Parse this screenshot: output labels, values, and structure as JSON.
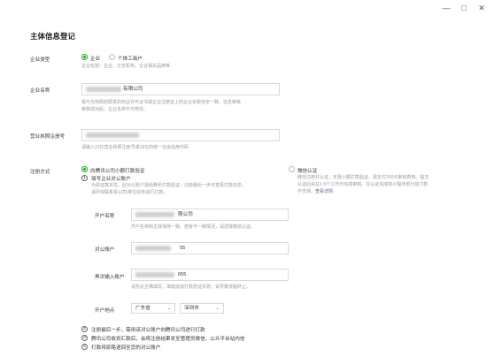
{
  "window": {
    "minimize": "—",
    "maximize": "□",
    "close": "✕"
  },
  "page_title": "主体信息登记",
  "company_type": {
    "label": "企业类型",
    "options": [
      "企业",
      "个体工商户"
    ],
    "selected": "企业",
    "hint": "企业包括：企业、分支机构、企业相关品牌等"
  },
  "company_name": {
    "label": "企业名称",
    "value_suffix": "有限公司",
    "hint_line1": "需与当地政府颁发的商业许可证书或企业注册证上的企业名称完全一致，信息审核",
    "hint_line2": "审核成功后，企业名称不可修改。"
  },
  "license_no": {
    "label": "营业执照注册号",
    "hint": "请输入15位营业执照注册号或18位的统一社会信用代码"
  },
  "verify": {
    "label": "注册方式",
    "option1": "向腾讯公司小额打款验证",
    "option2": "微信认证",
    "option2_hint_line1": "微信注册并认证，无需小额打款验证，需支付300元审核费用。提交",
    "option2_hint_line2": "认证后会在1-5个工作日完成审核。在认证完成前小程序部分能力暂",
    "option2_hint_line3": "不支持。",
    "option2_link": "查看详情",
    "steps": [
      {
        "num": "1",
        "text": "填写企业对公账户"
      },
      {
        "num": "2",
        "text": "注册最后一步，需用该对公账户向腾讯公司进行打款"
      },
      {
        "num": "3",
        "text": "腾讯公司收到汇款后，会将注册结果发至管理员微信、公众平台站内信"
      },
      {
        "num": "4",
        "text": "打款将原路退回至您的对公账户"
      }
    ],
    "step1_hint_line1": "为验证真实性，此对公账户需给腾讯打款验证，注册最后一步可查看打款信息，",
    "step1_hint_line2": "请尽快联系贵公司/单位财务进行打款。",
    "account_name_label": "开户名称",
    "account_name_suffix": "限公司",
    "account_name_hint": "开户名称和主体保持一致。若有不一致情况，请选择微信认证。",
    "account_label": "对公账户",
    "account_suffix": "55",
    "account_repeat_label": "再次输入账户",
    "account_repeat_suffix": "655",
    "account_repeat_hint": "请务必正确填写，填错造成打款验证失败，会导致流程终止。",
    "location_label": "开户地点",
    "province": "广东省",
    "city": "深圳市"
  }
}
